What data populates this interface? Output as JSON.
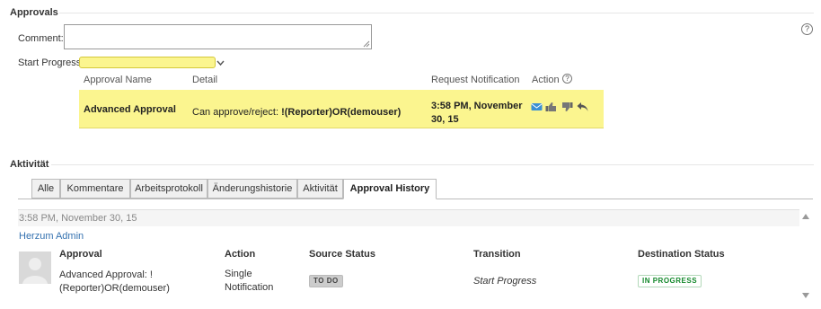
{
  "approvals": {
    "title": "Approvals",
    "help_icon": "?",
    "comment_label": "Comment:",
    "comment_value": "",
    "start_label": "Start Progress",
    "start_value": "",
    "columns": [
      "Approval Name",
      "Detail",
      "Request Notification",
      "Action"
    ],
    "row": {
      "name": "Advanced Approval",
      "detail_prefix": "Can approve/reject: ",
      "detail_value": "!(Reporter)OR(demouser)",
      "notification": "3:58 PM, November 30, 15",
      "actions": [
        "envelope-icon",
        "thumbs-up-icon",
        "thumbs-down-icon",
        "reply-icon"
      ]
    },
    "accent_color": "#fbf58f"
  },
  "activity": {
    "title": "Aktivität",
    "tabs": [
      "Alle",
      "Kommentare",
      "Arbeitsprotokoll",
      "Änderungshistorie",
      "Aktivität",
      "Approval History"
    ],
    "active_tab": "Approval History",
    "history": {
      "timestamp": "3:58 PM, November 30, 15",
      "user": "Herzum Admin",
      "columns": [
        "Approval",
        "Action",
        "Source Status",
        "Transition",
        "Destination Status"
      ],
      "approval": "Advanced Approval: ! (Reporter)OR(demouser)",
      "action": "Single Notification",
      "source_status": "TO DO",
      "transition": "Start Progress",
      "destination_status": "IN PROGRESS"
    },
    "colors": {
      "link": "#3572b0",
      "in_progress": "#14892c",
      "todo_bg": "#cccccc"
    }
  }
}
